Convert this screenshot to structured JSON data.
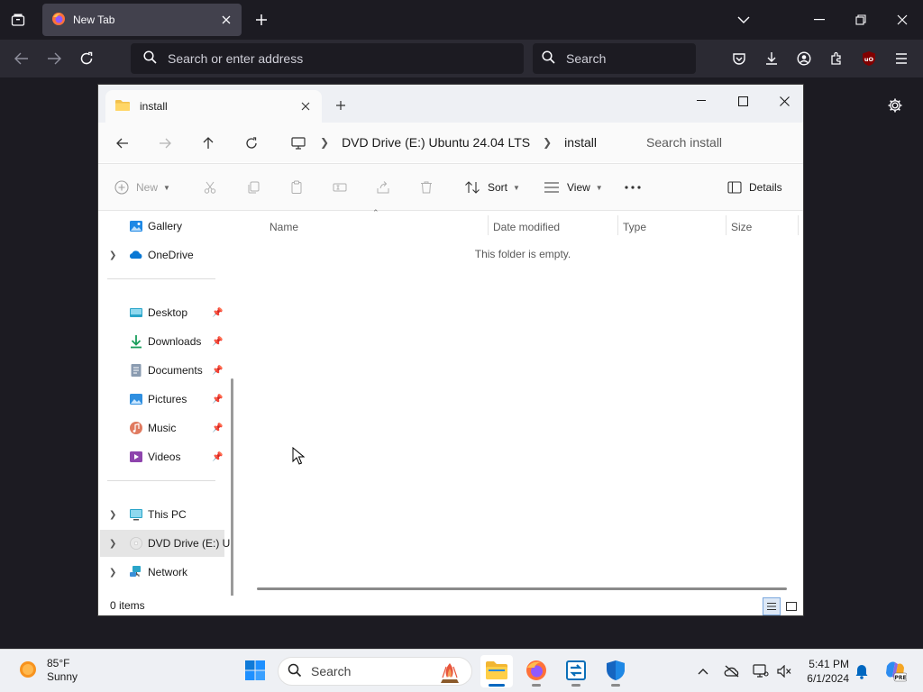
{
  "browser": {
    "tab_title": "New Tab",
    "url_placeholder": "Search or enter address",
    "search_placeholder": "Search",
    "ublock_badge": "uO"
  },
  "explorer": {
    "tab_title": "install",
    "breadcrumb": [
      "DVD Drive (E:) Ubuntu 24.04 LTS",
      "install"
    ],
    "search_placeholder": "Search install",
    "toolbar": {
      "new_label": "New",
      "sort_label": "Sort",
      "view_label": "View",
      "details_label": "Details"
    },
    "sidebar": {
      "gallery": "Gallery",
      "onedrive": "OneDrive",
      "desktop": "Desktop",
      "downloads": "Downloads",
      "documents": "Documents",
      "pictures": "Pictures",
      "music": "Music",
      "videos": "Videos",
      "this_pc": "This PC",
      "dvd_drive": "DVD Drive (E:) U",
      "network": "Network"
    },
    "columns": [
      "Name",
      "Date modified",
      "Type",
      "Size"
    ],
    "empty_message": "This folder is empty.",
    "status": "0 items"
  },
  "taskbar": {
    "weather_temp": "85°F",
    "weather_cond": "Sunny",
    "search_label": "Search",
    "time": "5:41 PM",
    "date": "6/1/2024",
    "copilot_badge": "PRE"
  },
  "colors": {
    "accent": "#0067c0",
    "folder": "#f2c14e",
    "firefox_bg": "#1c1b22"
  }
}
